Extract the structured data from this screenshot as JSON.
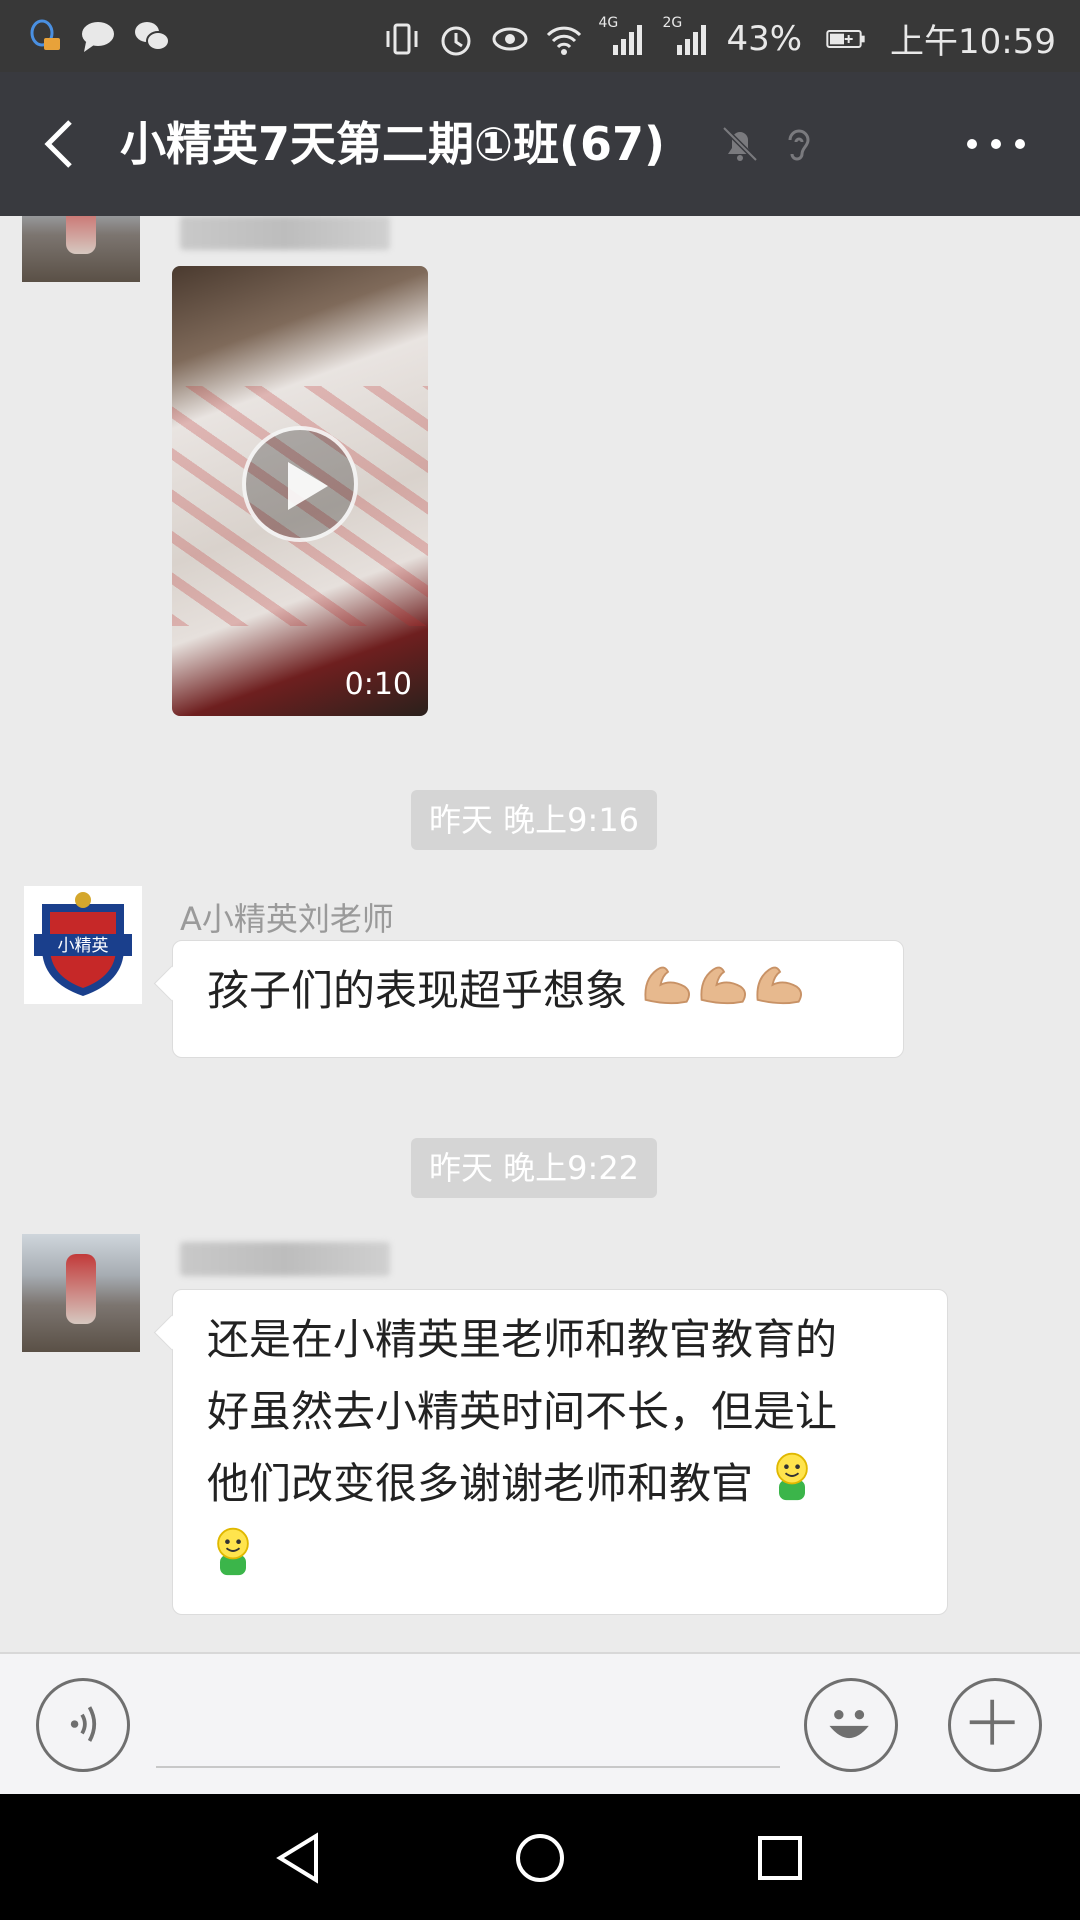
{
  "status_bar": {
    "signal_4g": "4G",
    "signal_2g": "2G",
    "battery": "43%",
    "time": "上午10:59"
  },
  "header": {
    "title": "小精英7天第二期①班(67)"
  },
  "messages": [
    {
      "type": "video",
      "duration": "0:10"
    },
    {
      "type": "timestamp",
      "text": "昨天 晚上9:16"
    },
    {
      "type": "text",
      "sender": "A小精英刘老师",
      "text": "孩子们的表现超乎想象"
    },
    {
      "type": "timestamp",
      "text": "昨天 晚上9:22"
    },
    {
      "type": "text",
      "text_lines": [
        "还是在小精英里老师和教官教育的",
        "好虽然去小精英时间不长，但是让",
        "他们改变很多谢谢老师和教官"
      ]
    }
  ],
  "logo": {
    "text": "小精英"
  },
  "colors": {
    "title_bar": "#393a3f",
    "status_bar": "#383838",
    "chat_bg": "#ebebeb",
    "timestamp_bg": "#d5d5d5"
  }
}
